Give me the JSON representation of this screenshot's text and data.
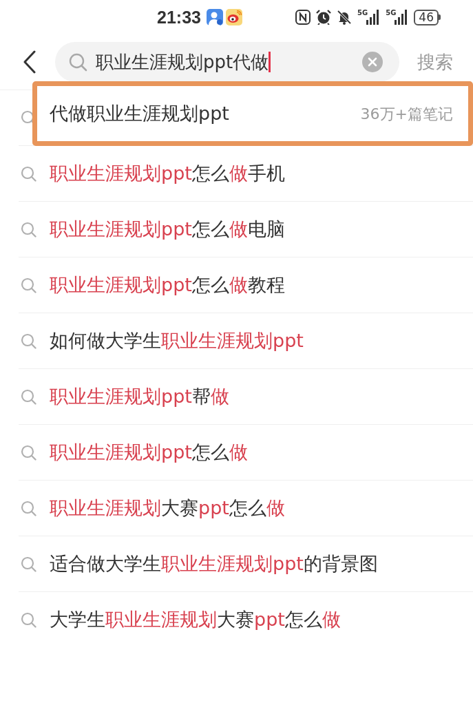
{
  "status_bar": {
    "time": "21:33",
    "signals": [
      {
        "label": "5G"
      },
      {
        "label": "5G"
      }
    ],
    "battery": "46"
  },
  "header": {
    "search": {
      "value": "职业生涯规划ppt代做",
      "focused": true
    },
    "search_button": "搜索"
  },
  "suggestions": [
    {
      "segments": [
        {
          "text": "代做职业生涯规划ppt",
          "match": false
        }
      ],
      "count": "36万+篇笔记",
      "annotated": true
    },
    {
      "segments": [
        {
          "text": "职业生涯规划ppt",
          "match": true
        },
        {
          "text": "怎么",
          "match": false
        },
        {
          "text": "做",
          "match": true
        },
        {
          "text": "手机",
          "match": false
        }
      ],
      "annotated": false
    },
    {
      "segments": [
        {
          "text": "职业生涯规划ppt",
          "match": true
        },
        {
          "text": "怎么",
          "match": false
        },
        {
          "text": "做",
          "match": true
        },
        {
          "text": "电脑",
          "match": false
        }
      ],
      "annotated": false
    },
    {
      "segments": [
        {
          "text": "职业生涯规划ppt",
          "match": true
        },
        {
          "text": "怎么",
          "match": false
        },
        {
          "text": "做",
          "match": true
        },
        {
          "text": "教程",
          "match": false
        }
      ],
      "annotated": false
    },
    {
      "segments": [
        {
          "text": "如何做大学生",
          "match": false
        },
        {
          "text": "职业生涯规划ppt",
          "match": true
        }
      ],
      "annotated": false
    },
    {
      "segments": [
        {
          "text": "职业生涯规划ppt",
          "match": true
        },
        {
          "text": "帮",
          "match": false
        },
        {
          "text": "做",
          "match": true
        }
      ],
      "annotated": false
    },
    {
      "segments": [
        {
          "text": "职业生涯规划ppt",
          "match": true
        },
        {
          "text": "怎么",
          "match": false
        },
        {
          "text": "做",
          "match": true
        }
      ],
      "annotated": false
    },
    {
      "segments": [
        {
          "text": "职业生涯规划",
          "match": true
        },
        {
          "text": "大赛",
          "match": false
        },
        {
          "text": "ppt",
          "match": true
        },
        {
          "text": "怎么",
          "match": false
        },
        {
          "text": "做",
          "match": true
        }
      ],
      "annotated": false
    },
    {
      "segments": [
        {
          "text": "适合做大学生",
          "match": false
        },
        {
          "text": "职业生涯规划ppt",
          "match": true
        },
        {
          "text": "的背景图",
          "match": false
        }
      ],
      "annotated": false
    },
    {
      "segments": [
        {
          "text": "大学生",
          "match": false
        },
        {
          "text": "职业生涯规划",
          "match": true
        },
        {
          "text": "大赛",
          "match": false
        },
        {
          "text": "ppt",
          "match": true
        },
        {
          "text": "怎么",
          "match": false
        },
        {
          "text": "做",
          "match": true
        }
      ],
      "annotated": false
    }
  ]
}
